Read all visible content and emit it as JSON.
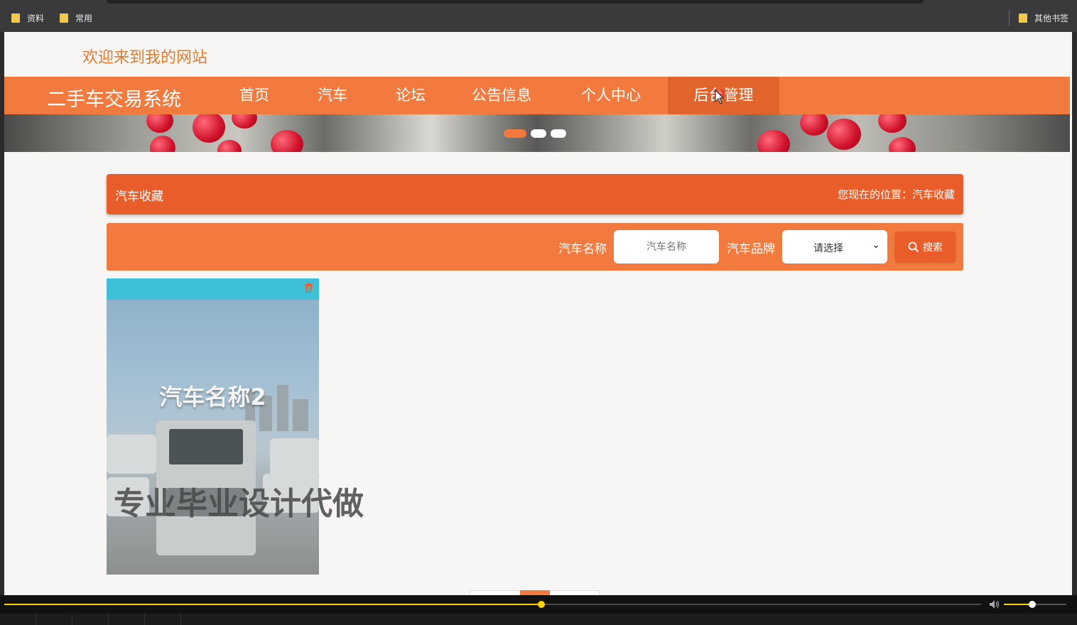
{
  "bookmarks": {
    "items": [
      "资料",
      "常用"
    ],
    "other": "其他书签"
  },
  "site": {
    "welcome": "欢迎来到我的网站",
    "brand": "二手车交易系统"
  },
  "nav": {
    "items": [
      "首页",
      "汽车",
      "论坛",
      "公告信息",
      "个人中心",
      "后台管理"
    ],
    "active_index": 5
  },
  "banner": {
    "slide_count": 3,
    "active_slide": 1
  },
  "breadcrumb": {
    "title": "汽车收藏",
    "location": "您现在的位置：汽车收藏"
  },
  "search": {
    "name_label": "汽车名称",
    "name_placeholder": "汽车名称",
    "brand_label": "汽车品牌",
    "brand_selected": "请选择",
    "button_label": "搜索"
  },
  "cards": [
    {
      "title": "汽车名称2"
    }
  ],
  "overlay_text": "专业毕业设计代做",
  "player": {
    "progress": 0.55,
    "volume": 0.45
  },
  "colors": {
    "primary": "#f27a3e",
    "primary_dark": "#e95d2b",
    "accent_text": "#e07a2e",
    "progress": "#f6d300"
  }
}
